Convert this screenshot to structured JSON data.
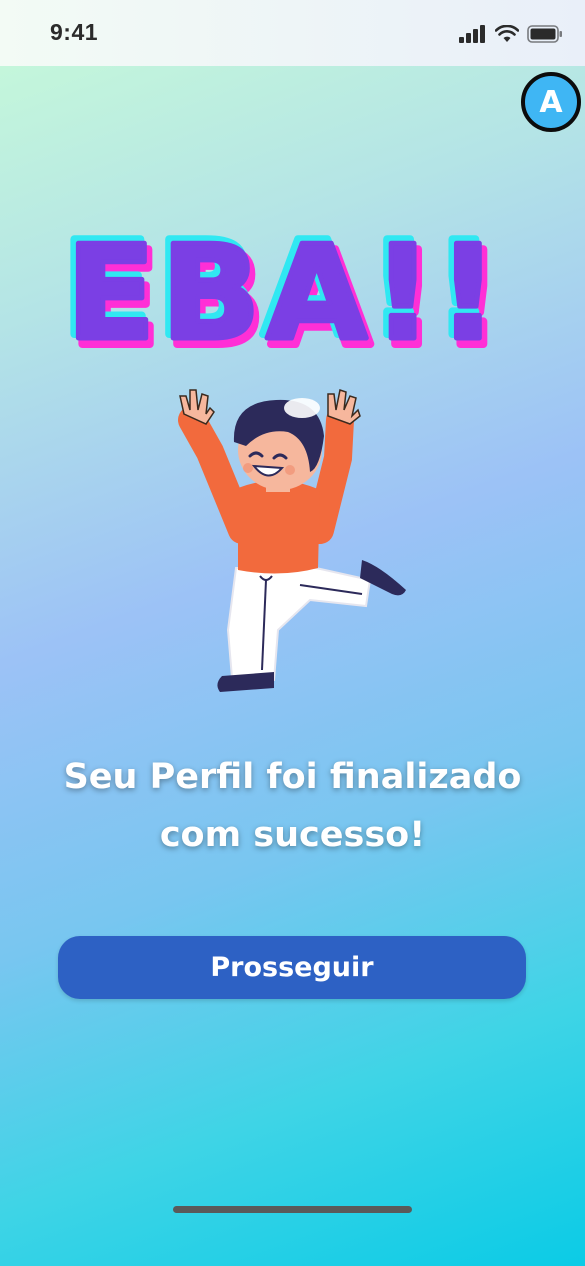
{
  "status_bar": {
    "time": "9:41"
  },
  "avatar": {
    "letter": "A"
  },
  "headline": {
    "text": "EBA!!"
  },
  "message": {
    "line1": "Seu Perfil foi finalizado",
    "line2": "com sucesso!"
  },
  "button": {
    "label": "Prosseguir"
  },
  "colors": {
    "headline_fill": "#7b3fe4",
    "headline_pink": "#ff2fd6",
    "headline_cyan": "#30e8f2",
    "button": "#2d61c4",
    "avatar": "#3fb6f4"
  },
  "icons": [
    "signal-icon",
    "wifi-icon",
    "battery-icon",
    "celebration-illustration"
  ]
}
